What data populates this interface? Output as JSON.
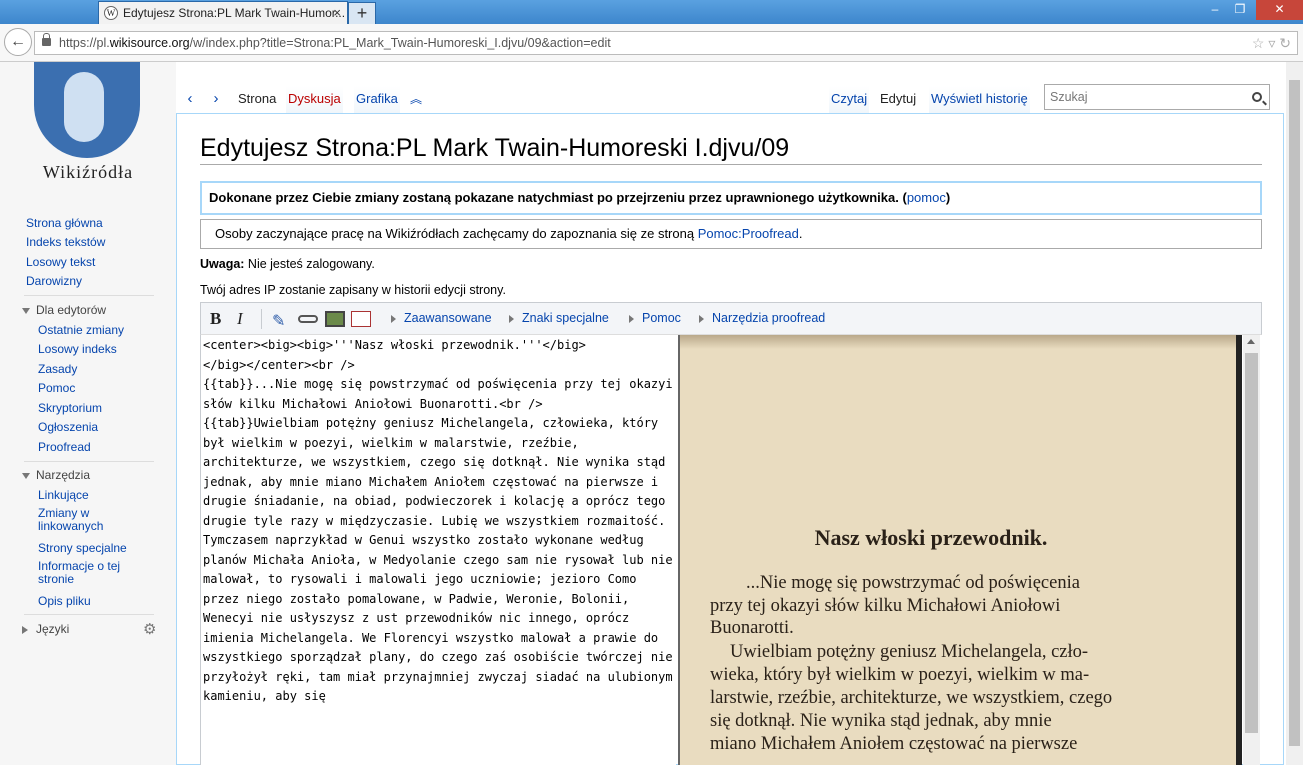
{
  "browser": {
    "tab_title": "Edytujesz Strona:PL Mark Twain-Humor...",
    "tab_close": "×",
    "new_tab": "+",
    "url_prefix": "https://pl.",
    "url_domain": "wikisource.org",
    "url_rest": "/w/index.php?title=Strona:PL_Mark_Twain-Humoreski_I.djvu/09&action=edit",
    "win_min": "–",
    "win_max": "❐",
    "win_close": "✕"
  },
  "sidebar": {
    "logo_text": "Wikiźródła",
    "main_links": [
      "Strona główna",
      "Indeks tekstów",
      "Losowy tekst",
      "Darowizny"
    ],
    "editors_header": "Dla edytorów",
    "editors_links": [
      "Ostatnie zmiany",
      "Losowy indeks",
      "Zasady",
      "Pomoc",
      "Skryptorium",
      "Ogłoszenia",
      "Proofread"
    ],
    "tools_header": "Narzędzia",
    "tools_links": [
      "Linkujące",
      "Zmiany w linkowanych",
      "Strony specjalne",
      "Informacje o tej stronie",
      "Opis pliku"
    ],
    "languages_header": "Języki"
  },
  "tabs": {
    "prev": "<",
    "next": ">",
    "page": "Strona",
    "talk": "Dyskusja",
    "image": "Grafika",
    "up": "^",
    "read": "Czytaj",
    "edit": "Edytuj",
    "history": "Wyświetl historię"
  },
  "search": {
    "placeholder": "Szukaj"
  },
  "page": {
    "title": "Edytujesz Strona:PL Mark Twain-Humoreski I.djvu/09",
    "notice1_text": "Dokonane przez Ciebie zmiany zostaną pokazane natychmiast po przejrzeniu przez uprawnionego użytkownika. (",
    "notice1_link": "pomoc",
    "notice1_end": ")",
    "notice2_text": "Osoby zaczynające pracę na Wikiźródłach zachęcamy do zapoznania się ze stroną ",
    "notice2_link": "Pomoc:Proofread",
    "notice2_end": ".",
    "warning_bold": "Uwaga:",
    "warning_text": " Nie jesteś zalogowany.",
    "ip_text": "Twój adres IP zostanie zapisany w historii edycji strony."
  },
  "toolbar": {
    "bold": "B",
    "italic": "I",
    "groups": [
      "Zaawansowane",
      "Znaki specjalne",
      "Pomoc",
      "Narzędzia proofread"
    ]
  },
  "editor": {
    "text": "<center><big><big>'''Nasz włoski przewodnik.'''</big>\n</big></center><br />\n{{tab}}...Nie mogę się powstrzymać od poświęcenia przy tej okazyi słów kilku Michałowi Aniołowi Buonarotti.<br />\n{{tab}}Uwielbiam potężny geniusz Michelangela, człowieka, który był wielkim w poezyi, wielkim w malarstwie, rzeźbie, architekturze, we wszystkiem, czego się dotknął. Nie wynika stąd jednak, aby mnie miano Michałem Aniołem częstować na pierwsze i drugie śniadanie, na obiad, podwieczorek i kolację a oprócz tego drugie tyle razy w międzyczasie. Lubię we wszystkiem rozmaitość. Tymczasem naprzykład w Genui wszystko zostało wykonane według planów Michała Anioła, w Medyolanie czego sam nie rysował lub nie malował, to rysowali i malowali jego uczniowie; jezioro Como przez niego zostało pomalowane, w Padwie, Weronie, Bolonii, Wenecyi nie usłyszysz z ust przewodników nic innego, oprócz imienia Michelangela. We Florencyi wszystko malował a prawie do wszystkiego sporządzał plany, do czego zaś osobiście twórczej nie przyłożył ręki, tam miał przynajmniej zwyczaj siadać na ulubionym kamieniu, aby się"
  },
  "scan": {
    "title": "Nasz włoski przewodnik.",
    "lines": [
      "...Nie mogę się powstrzymać od poświęcenia",
      "przy tej okazyi słów kilku Michałowi Aniołowi",
      "Buonarotti.",
      "Uwielbiam potężny geniusz Michelangela, czło-",
      "wieka, który był wielkim w poezyi, wielkim w ma-",
      "larstwie, rzeźbie, architekturze, we wszystkiem, czego",
      "się dotknął. Nie wynika stąd jednak, aby mnie",
      "miano Michałem Aniołem częstować na pierwsze"
    ]
  }
}
